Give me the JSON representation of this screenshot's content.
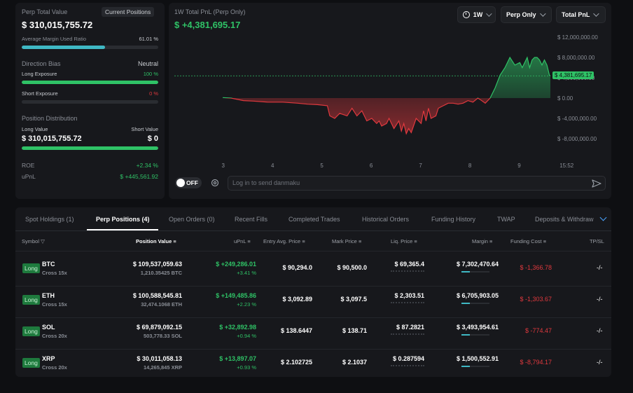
{
  "summary": {
    "title": "Perp Total Value",
    "mode_chip": "Current Positions",
    "total_value": "$ 310,015,755.72",
    "margin_ratio_label": "Average Margin Used Ratio",
    "margin_ratio_value": "61.01 %",
    "margin_ratio_fraction": 0.61,
    "direction_bias_label": "Direction Bias",
    "direction_bias_value": "Neutral",
    "long_exposure_label": "Long Exposure",
    "long_exposure_value": "100 %",
    "long_exposure_fraction": 1.0,
    "short_exposure_label": "Short Exposure",
    "short_exposure_value": "0 %",
    "short_exposure_fraction": 0.0,
    "distribution_label": "Position Distribution",
    "long_value_label": "Long Value",
    "long_value": "$ 310,015,755.72",
    "short_value_label": "Short Value",
    "short_value": "$ 0",
    "distribution_long_fraction": 1.0,
    "roe_label": "ROE",
    "roe_value": "+2.34 %",
    "upnl_label": "uPnL",
    "upnl_value": "$ +445,561.92"
  },
  "chart": {
    "title": "1W Total PnL (Perp Only)",
    "value": "$ +4,381,695.17",
    "range_select": "1W",
    "scope_select": "Perp Only",
    "metric_select": "Total PnL",
    "current_tag": "$ 4,381,695.17",
    "colors": {
      "positive": "#2fc266",
      "negative": "#e0393e"
    }
  },
  "chart_data": {
    "type": "area",
    "title": "1W Total PnL (Perp Only)",
    "ylim": [
      -10000000,
      14000000
    ],
    "y_ticks": [
      "$ 12,000,000.00",
      "$ 8,000,000.00",
      "$ 4,000,000.00",
      "$ 0.00",
      "$ -4,000,000.00",
      "$ -8,000,000.00"
    ],
    "x_ticks": [
      "3",
      "4",
      "5",
      "6",
      "7",
      "8",
      "9",
      "15:52"
    ],
    "current_value": 4381695.17,
    "x": [
      2.98,
      3.15,
      3.4,
      3.6,
      3.9,
      4.2,
      4.5,
      4.7,
      4.9,
      5.1,
      5.15,
      5.25,
      5.35,
      5.5,
      5.6,
      5.7,
      5.8,
      5.9,
      6.0,
      6.1,
      6.15,
      6.2,
      6.3,
      6.35,
      6.45,
      6.55,
      6.6,
      6.65,
      6.7,
      6.75,
      6.8,
      6.9,
      7.0,
      7.05,
      7.1,
      7.15,
      7.2,
      7.3,
      7.35,
      7.45,
      7.55,
      7.65,
      7.75,
      7.85,
      7.95,
      8.05,
      8.15,
      8.2,
      8.3,
      8.4,
      8.5,
      8.6,
      8.7,
      8.8,
      8.9,
      9.0,
      9.05,
      9.1,
      9.15,
      9.2,
      9.25,
      9.3,
      9.35,
      9.4,
      9.45,
      9.5,
      9.55,
      9.6,
      9.62
    ],
    "y": [
      0.1,
      0.0,
      -0.5,
      -0.6,
      -0.8,
      -0.8,
      -1.0,
      -1.2,
      -1.3,
      -1.5,
      -3.5,
      -4.0,
      -3.0,
      -3.5,
      -2.0,
      -3.5,
      -2.5,
      -4.5,
      -4.0,
      -5.0,
      -4.5,
      -5.5,
      -5.0,
      -4.0,
      -6.0,
      -4.5,
      -6.5,
      -5.0,
      -7.0,
      -6.0,
      -6.8,
      -4.0,
      -5.0,
      -2.5,
      -4.5,
      -2.0,
      -4.0,
      -3.5,
      -2.0,
      -1.5,
      -1.0,
      -1.0,
      -1.2,
      -1.0,
      -0.5,
      -0.8,
      0.0,
      -0.3,
      -1.0,
      0.0,
      2.0,
      4.5,
      6.0,
      8.0,
      6.5,
      7.0,
      6.0,
      7.0,
      8.0,
      6.0,
      7.5,
      8.0,
      8.0,
      7.5,
      6.5,
      7.5,
      6.5,
      4.5,
      4.4
    ]
  },
  "danmaku": {
    "toggle_label": "OFF",
    "placeholder": "Log in to send danmaku"
  },
  "tabs": [
    "Spot Holdings (1)",
    "Perp Positions (4)",
    "Open Orders (0)",
    "Recent Fills",
    "Completed Trades",
    "Historical Orders",
    "Funding History",
    "TWAP",
    "Deposits & Withdraw"
  ],
  "table": {
    "headers": {
      "symbol": "Symbol",
      "position_value": "Position Value",
      "upnl": "uPnL",
      "entry": "Entry Avg. Price",
      "mark": "Mark Price",
      "liq": "Liq. Price",
      "margin": "Margin",
      "funding": "Funding Cost",
      "tpsl": "TP/SL"
    },
    "rows": [
      {
        "side": "Long",
        "symbol": "BTC",
        "leverage": "Cross 15x",
        "value": "$ 109,537,059.63",
        "size": "1,210.35425 BTC",
        "upnl": "$ +249,286.01",
        "upnl_pct": "+3.41 %",
        "entry": "$ 90,294.0",
        "mark": "$ 90,500.0",
        "liq": "$ 69,365.4",
        "margin": "$ 7,302,470.64",
        "margin_fraction": 0.3,
        "funding": "$ -1,366.78",
        "tpsl": "-/-"
      },
      {
        "side": "Long",
        "symbol": "ETH",
        "leverage": "Cross 15x",
        "value": "$ 100,588,545.81",
        "size": "32,474.1068 ETH",
        "upnl": "$ +149,485.86",
        "upnl_pct": "+2.23 %",
        "entry": "$ 3,092.89",
        "mark": "$ 3,097.5",
        "liq": "$ 2,303.51",
        "margin": "$ 6,705,903.05",
        "margin_fraction": 0.3,
        "funding": "$ -1,303.67",
        "tpsl": "-/-"
      },
      {
        "side": "Long",
        "symbol": "SOL",
        "leverage": "Cross 20x",
        "value": "$ 69,879,092.15",
        "size": "503,778.33 SOL",
        "upnl": "$ +32,892.98",
        "upnl_pct": "+0.94 %",
        "entry": "$ 138.6447",
        "mark": "$ 138.71",
        "liq": "$ 87.2821",
        "margin": "$ 3,493,954.61",
        "margin_fraction": 0.3,
        "funding": "$ -774.47",
        "tpsl": "-/-"
      },
      {
        "side": "Long",
        "symbol": "XRP",
        "leverage": "Cross 20x",
        "value": "$ 30,011,058.13",
        "size": "14,265,845 XRP",
        "upnl": "$ +13,897.07",
        "upnl_pct": "+0.93 %",
        "entry": "$ 2.102725",
        "mark": "$ 2.1037",
        "liq": "$ 0.287594",
        "margin": "$ 1,500,552.91",
        "margin_fraction": 0.3,
        "funding": "$ -8,794.17",
        "tpsl": "-/-"
      }
    ]
  }
}
